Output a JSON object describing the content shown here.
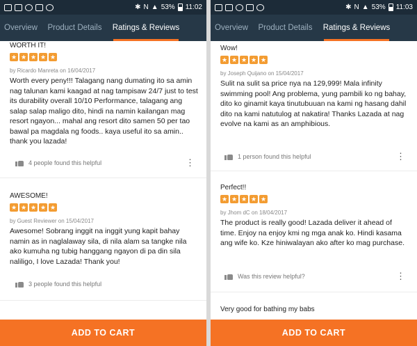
{
  "screens": [
    {
      "statusbar": {
        "battery": "53%",
        "time": "11:02",
        "carrier_mark": "N"
      },
      "tabs": [
        {
          "label": "Overview",
          "active": false
        },
        {
          "label": "Product Details",
          "active": false
        },
        {
          "label": "Ratings & Reviews",
          "active": true
        }
      ],
      "reviews": [
        {
          "title": "WORTH IT!",
          "rating": 5,
          "byline": "by Ricardo Manreta on 16/04/2017",
          "body": "Worth every peny!!! Talagang nang dumating ito sa amin nag talunan kami kaagad at nag tampisaw 24/7 just to test its durability overall 10/10 Performance, talagang ang salap salap maligo dito, hindi na namin kailangan mag resort ngayon... mahal ang resort dito samen 50 per tao bawal pa magdala ng foods.. kaya useful ito sa amin.. thank you lazada!",
          "helpful": "4 people found this helpful"
        },
        {
          "title": "AWESOME!",
          "rating": 5,
          "byline": "by Guest Reviewer on 15/04/2017",
          "body": "Awesome! Sobrang inggit na inggit yung kapit bahay namin as in naglalaway sila, di nila alam sa tangke nila ako kumuha ng tubig hanggang ngayon di pa din sila naliligo, I love Lazada! Thank you!",
          "helpful": "3 people found this helpful"
        }
      ],
      "cta_label": "ADD TO CART"
    },
    {
      "statusbar": {
        "battery": "53%",
        "time": "11:03",
        "carrier_mark": "N"
      },
      "tabs": [
        {
          "label": "Overview",
          "active": false
        },
        {
          "label": "Product Details",
          "active": false
        },
        {
          "label": "Ratings & Reviews",
          "active": true
        }
      ],
      "reviews": [
        {
          "title": "Wow!",
          "rating": 5,
          "byline": "by Joseph Quijano on 15/04/2017",
          "body": "Sulit na sulit sa price nya na 129,999! Mala infinity swimming pool! Ang problema, yung pambili ko ng bahay, dito ko ginamit kaya tinutubuuan na kami ng hasang dahil dito na kami natutulog at nakatira! Thanks Lazada at nag evolve na kami as an amphibious.",
          "helpful": "1 person found this helpful"
        },
        {
          "title": "Perfect!!",
          "rating": 5,
          "byline": "by Jhom dC on 18/04/2017",
          "body": "The product is really good! Lazada deliver it ahead of time. Enjoy na enjoy kmi ng mga anak ko. Hindi kasama ang wife ko. Kze hiniwalayan ako after ko mag purchase.",
          "helpful": "Was this review helpful?"
        },
        {
          "title": "Very good for bathing my babs"
        }
      ],
      "cta_label": "ADD TO CART"
    }
  ]
}
